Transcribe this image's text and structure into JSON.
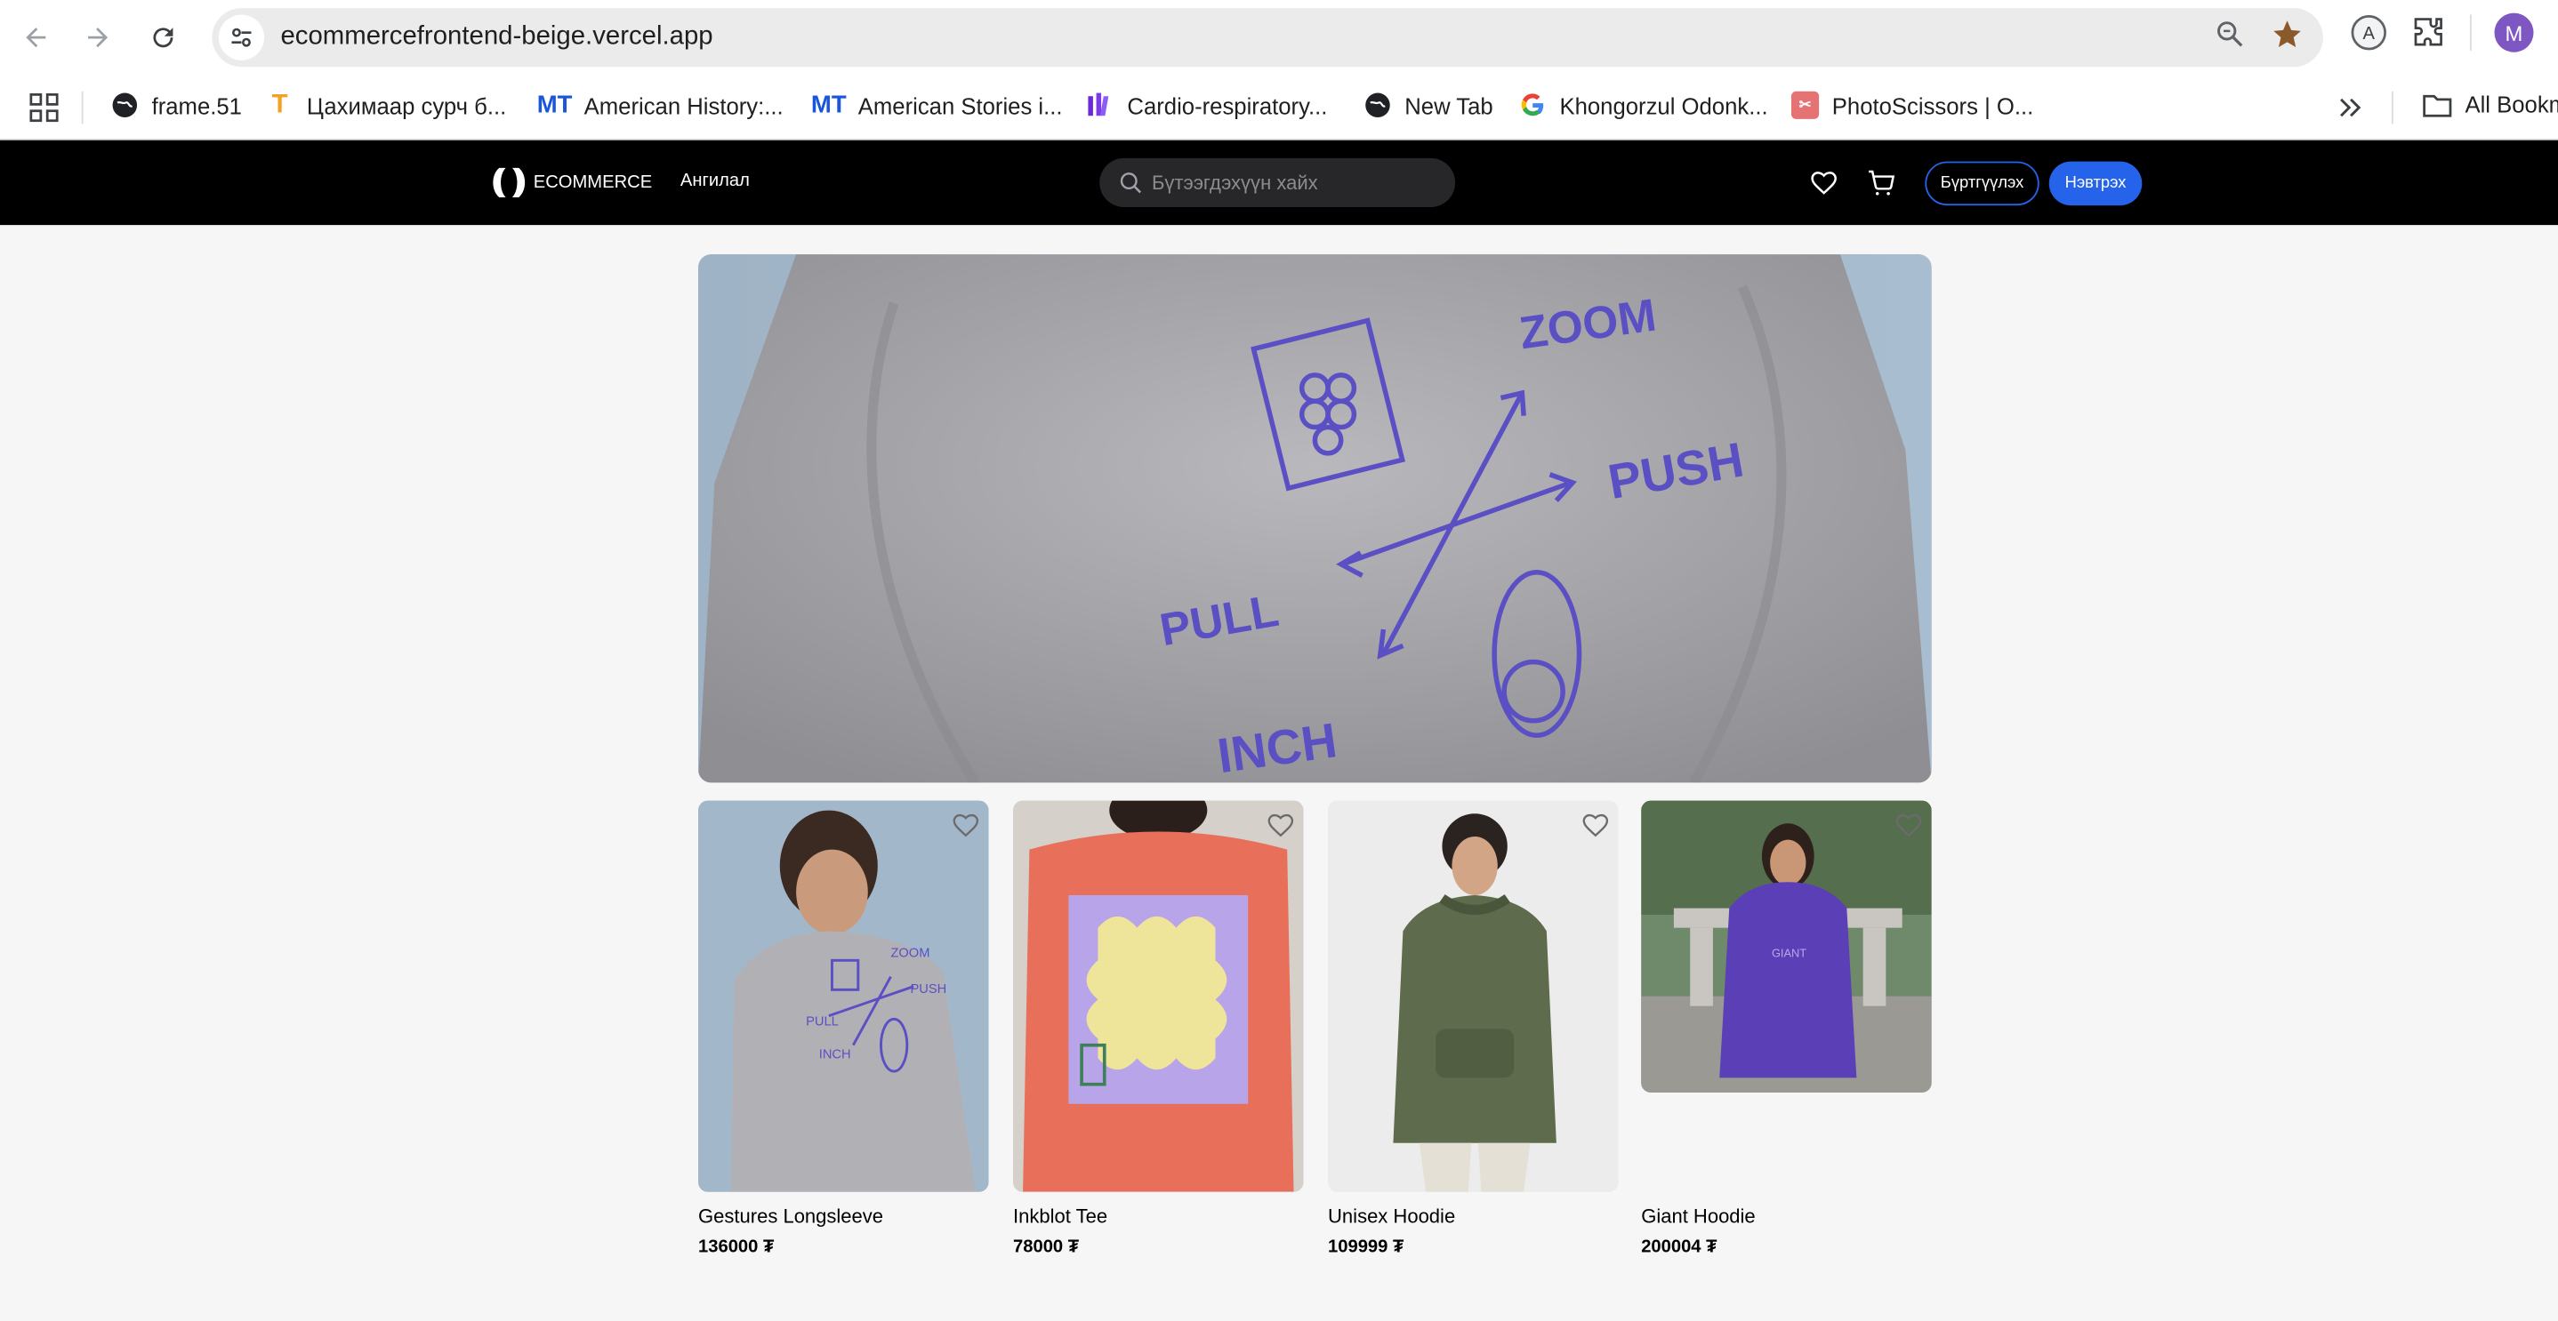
{
  "browser": {
    "url": "ecommercefrontend-beige.vercel.app",
    "profile_initial": "M",
    "bookmarks": [
      {
        "label": "frame.51",
        "icon": "globe-icon"
      },
      {
        "label": "Цахимаар сурч б...",
        "icon": "t-logo-icon"
      },
      {
        "label": "American History:...",
        "icon": "mt-logo-icon"
      },
      {
        "label": "American Stories i...",
        "icon": "mt-logo-icon"
      },
      {
        "label": "Cardio-respiratory...",
        "icon": "bars-logo-icon"
      },
      {
        "label": "New Tab",
        "icon": "globe-icon"
      },
      {
        "label": "Khongorzul Odonk...",
        "icon": "google-icon"
      },
      {
        "label": "PhotoScissors | O...",
        "icon": "photoscissors-icon"
      }
    ],
    "all_bookmarks_label": "All Bookm"
  },
  "site": {
    "logo_text": "ECOMMERCE",
    "category_link": "Ангилал",
    "search_placeholder": "Бүтээгдэхүүн хайх",
    "register_label": "Бүртгүүлэх",
    "login_label": "Нэвтрэх",
    "colors": {
      "header_bg": "#000000",
      "accent": "#2563eb"
    }
  },
  "hero": {
    "print_words": [
      "ZOOM",
      "PUSH",
      "PULL",
      "INCH"
    ]
  },
  "products": [
    {
      "name": "Gestures Longsleeve",
      "price": "136000 ₮"
    },
    {
      "name": "Inkblot Tee",
      "price": "78000 ₮"
    },
    {
      "name": "Unisex Hoodie",
      "price": "109999 ₮"
    },
    {
      "name": "Giant Hoodie",
      "price": "200004 ₮"
    }
  ]
}
